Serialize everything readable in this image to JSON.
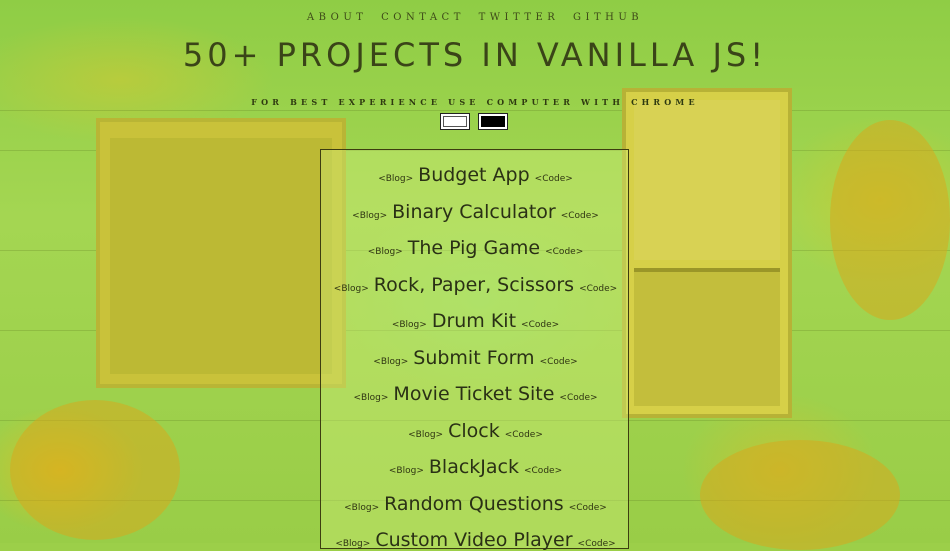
{
  "nav": {
    "items": [
      "About",
      "Contact",
      "Twitter",
      "Github"
    ]
  },
  "header": {
    "title": "50+ PROJECTS IN VANILLA JS!",
    "subtitle": "For best experience use computer with chrome"
  },
  "theme_toggles": [
    {
      "name": "light-theme",
      "color": "#ffffff"
    },
    {
      "name": "dark-theme",
      "color": "#000000"
    }
  ],
  "projects": {
    "blog_label": "<Blog>",
    "code_label": "<Code>",
    "items": [
      "Budget App",
      "Binary Calculator",
      "The Pig Game",
      "Rock, Paper, Scissors",
      "Drum Kit",
      "Submit Form",
      "Movie Ticket Site",
      "Clock",
      "BlackJack",
      "Random Questions",
      "Custom Video Player"
    ]
  },
  "colors": {
    "text": "#3a4418",
    "background": "#9ccf49"
  }
}
